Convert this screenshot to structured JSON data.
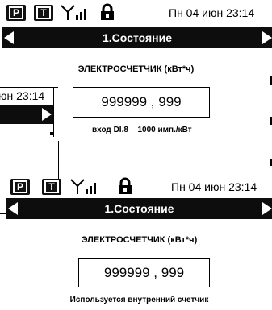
{
  "screen_top": {
    "datetime": "Пн 04 июн 23:14",
    "title": "1.Состояние",
    "meter_label": "ЭЛЕКТРОСЧЕТЧИК (кВт*ч)",
    "value": "999999 , 999",
    "input_info": "вход DI.8",
    "pulse_rate": "1000 имп./кВт"
  },
  "screen_left_partial": {
    "datetime_fragment": "юн 23:14"
  },
  "screen_bottom": {
    "datetime": "Пн 04 июн 23:14",
    "title": "1.Состояние",
    "meter_label": "ЭЛЕКТРОСЧЕТЧИК (кВт*ч)",
    "value": "999999 , 999",
    "info": "Используется внутренний счетчик"
  },
  "status_icons": {
    "p_icon": "P",
    "t_icon": "T",
    "signal_icon": "antenna-signal",
    "lock_icon": "lock"
  }
}
